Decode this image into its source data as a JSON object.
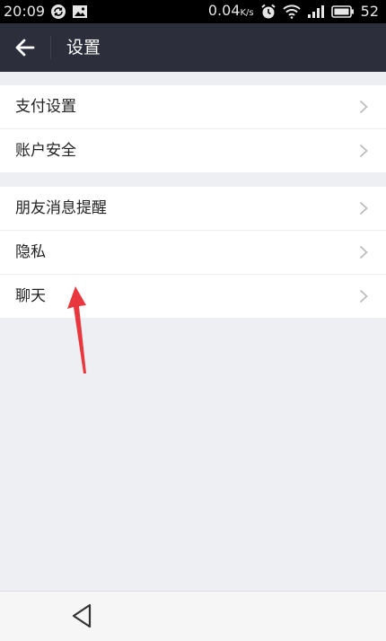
{
  "status_bar": {
    "time": "20:09",
    "net_speed": "0.04",
    "net_unit": "K/s",
    "battery": "52"
  },
  "app_bar": {
    "title": "设置"
  },
  "settings": {
    "group1": [
      {
        "label": "支付设置"
      },
      {
        "label": "账户安全"
      }
    ],
    "group2": [
      {
        "label": "朋友消息提醒"
      },
      {
        "label": "隐私"
      },
      {
        "label": "聊天"
      }
    ]
  },
  "colors": {
    "app_bar": "#2c2f3b",
    "page_background": "#eeeff2",
    "annotation_arrow": "#e8383d"
  }
}
